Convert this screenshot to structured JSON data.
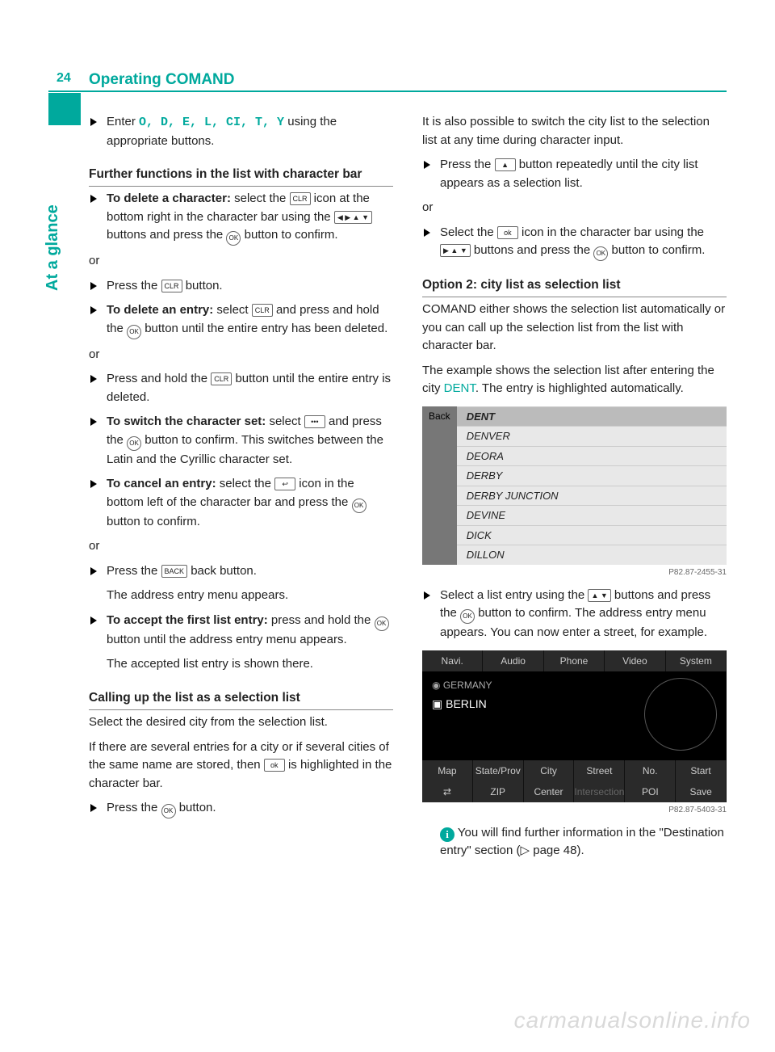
{
  "page_number": "24",
  "page_title": "Operating COMAND",
  "side_label": "At a glance",
  "left": {
    "enter_line_a": "Enter ",
    "enter_seq": "O, D, E, L, CI, T, Y",
    "enter_line_b": " using the appropriate buttons.",
    "h1": "Further functions in the list with character bar",
    "del_char_a": "To delete a character:",
    "del_char_b": " select the ",
    "del_char_c": " icon at the bottom right in the character bar using the ",
    "del_char_d": " buttons and press the ",
    "del_char_e": " button to confirm.",
    "or": "or",
    "press_clr": "Press the ",
    "press_clr_b": " button.",
    "del_entry_a": "To delete an entry:",
    "del_entry_b": " select ",
    "del_entry_c": " and press and hold the ",
    "del_entry_d": " button until the entire entry has been deleted.",
    "press_hold_a": "Press and hold the ",
    "press_hold_b": " button until the entire entry is deleted.",
    "switch_a": "To switch the character set:",
    "switch_b": " select ",
    "switch_c": " and press the ",
    "switch_d": " button to confirm. This switches between the Latin and the Cyrillic character set.",
    "cancel_a": "To cancel an entry:",
    "cancel_b": " select the ",
    "cancel_c": " icon in the bottom left of the character bar and press the ",
    "cancel_d": " button to confirm.",
    "back_a": "Press the ",
    "back_b": " back button.",
    "back_c": "The address entry menu appears.",
    "accept_a": "To accept the first list entry:",
    "accept_b": " press and hold the ",
    "accept_c": " button until the address entry menu appears.",
    "accept_d": "The accepted list entry is shown there.",
    "h2": "Calling up the list as a selection list",
    "call_p1": "Select the desired city from the selection list.",
    "call_p2a": "If there are several entries for a city or if several cities of the same name are stored, then ",
    "call_p2b": " is highlighted in the character bar.",
    "call_last": "Press the ",
    "call_last_b": " button."
  },
  "right": {
    "p1": "It is also possible to switch the city list to the selection list at any time during character input.",
    "press_rep_a": "Press the ",
    "press_rep_b": " button repeatedly until the city list appears as a selection list.",
    "or": "or",
    "sel_ok_a": "Select the ",
    "sel_ok_b": " icon in the character bar using the ",
    "sel_ok_c": " buttons and press the ",
    "sel_ok_d": " button to confirm.",
    "h1": "Option 2: city list as selection list",
    "p2": "COMAND either shows the selection list automatically or you can call up the selection list from the list with character bar.",
    "p3a": "The example shows the selection list after entering the city ",
    "p3_city": "DENT",
    "p3b": ". The entry is highlighted automatically.",
    "fig1_back": "Back",
    "fig1_rows": [
      "DENT",
      "DENVER",
      "DEORA",
      "DERBY",
      "DERBY JUNCTION",
      "DEVINE",
      "DICK",
      "DILLON"
    ],
    "fig1_cap": "P82.87-2455-31",
    "sel_list_a": "Select a list entry using the ",
    "sel_list_b": " buttons and press the ",
    "sel_list_c": " button to confirm. The address entry menu appears. You can now enter a street, for example.",
    "fig2_top": [
      "Navi.",
      "Audio",
      "Phone",
      "Video",
      "System"
    ],
    "fig2_g1": "GERMANY",
    "fig2_g2": "BERLIN",
    "fig2_bot1": [
      "Map",
      "State/Prov",
      "City",
      "Street",
      "No.",
      "Start"
    ],
    "fig2_bot2": [
      "⇄",
      "ZIP",
      "Center",
      "Intersection",
      "POI",
      "Save"
    ],
    "fig2_cap": "P82.87-5403-31",
    "info": " You will find further information in the \"Destination entry\" section (",
    "info_pg": " page 48)."
  },
  "keys": {
    "clr": "CLR",
    "ok": "OK",
    "back": "BACK",
    "oksmall": "ok",
    "arrows4": "◀ ▶ ▲ ▼",
    "arrows3": "▶ ▲ ▼",
    "arrows2": "▲ ▼",
    "up": "▲",
    "lang": "•••",
    "ret": "↩"
  },
  "watermark": "carmanualsonline.info"
}
